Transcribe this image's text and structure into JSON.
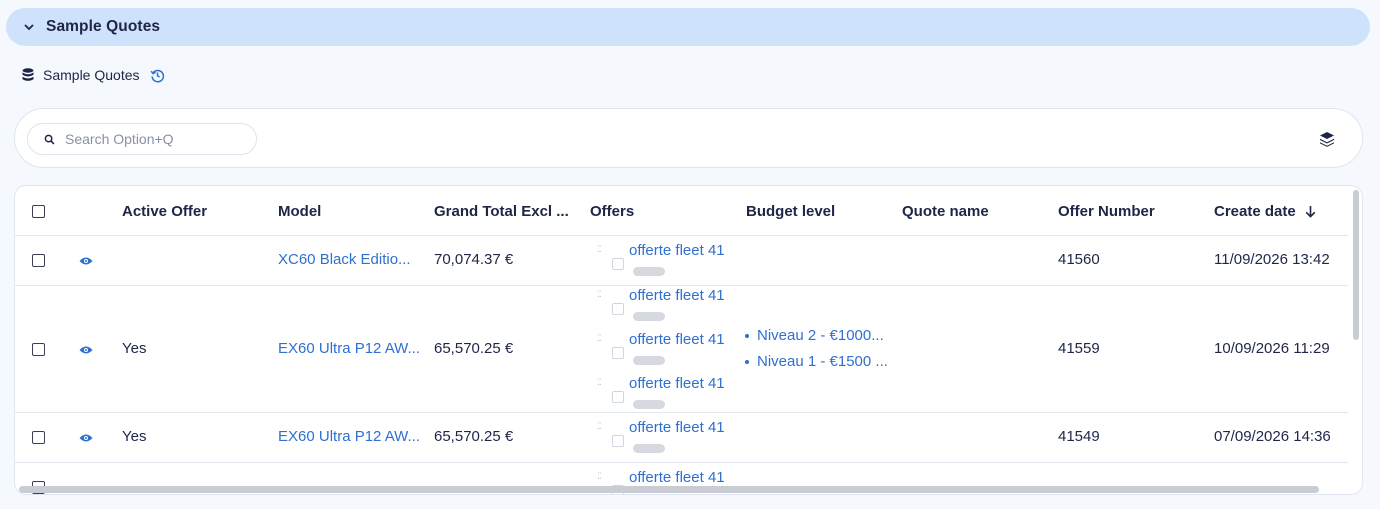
{
  "section": {
    "title": "Sample Quotes",
    "toggle_icon": "chevron-down-icon"
  },
  "object": {
    "label": "Sample Quotes",
    "db_icon": "database-icon",
    "history_icon": "history-icon"
  },
  "search": {
    "placeholder": "Search Option+Q",
    "value": ""
  },
  "table": {
    "columns": [
      "Active Offer",
      "Model",
      "Grand Total Excl ...",
      "Offers",
      "Budget level",
      "Quote name",
      "Offer Number",
      "Create date"
    ],
    "sort_column": "Create date",
    "sort_direction": "desc",
    "rows": [
      {
        "active": "",
        "model": "XC60 Black Editio...",
        "total": "70,074.37 €",
        "offers": [
          "offerte fleet 41"
        ],
        "budget": [],
        "quote_name": "",
        "offer_number": "41560",
        "create_date": "11/09/2026 13:42"
      },
      {
        "active": "Yes",
        "model": "EX60 Ultra P12 AW...",
        "total": "65,570.25 €",
        "offers": [
          "offerte fleet 41",
          "offerte fleet 41",
          "offerte fleet 41"
        ],
        "budget": [
          "Niveau 2 - €1000...",
          "Niveau 1 - €1500 ..."
        ],
        "quote_name": "",
        "offer_number": "41559",
        "create_date": "10/09/2026 11:29"
      },
      {
        "active": "Yes",
        "model": "EX60 Ultra P12 AW...",
        "total": "65,570.25 €",
        "offers": [
          "offerte fleet 41"
        ],
        "budget": [],
        "quote_name": "",
        "offer_number": "41549",
        "create_date": "07/09/2026 14:36"
      },
      {
        "active": "",
        "model": "",
        "total": "",
        "offers": [
          "offerte fleet 41"
        ],
        "budget": [],
        "quote_name": "",
        "offer_number": "",
        "create_date": ""
      }
    ]
  },
  "colors": {
    "header_bg": "#cfe2fb",
    "link": "#2f6fd1",
    "text": "#1f2547"
  }
}
